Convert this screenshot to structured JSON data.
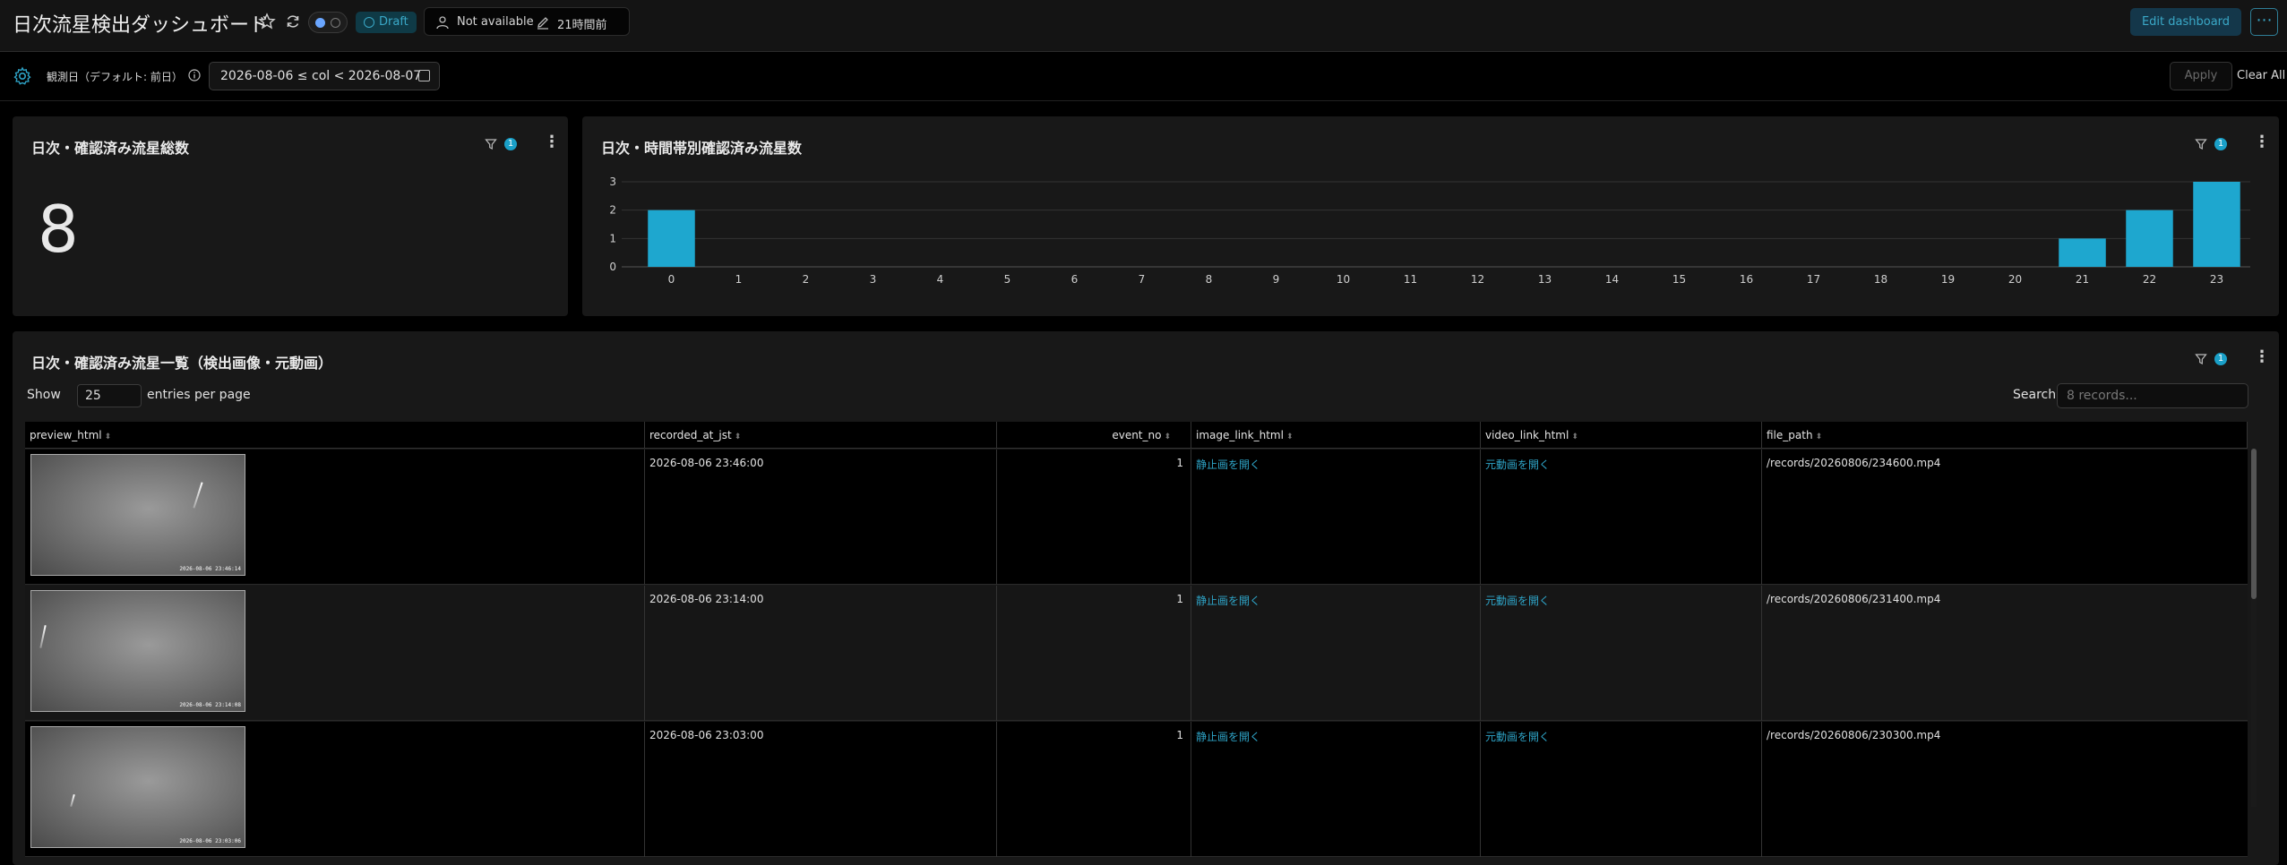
{
  "header": {
    "title": "日次流星検出ダッシュボード",
    "status_badge": "Draft",
    "owner": "Not available",
    "modified": "21時間前",
    "edit_button": "Edit dashboard",
    "more_button": "⋯"
  },
  "filter_bar": {
    "label": "観測日（デフォルト: 前日）",
    "date_range": "2026-08-06 ≤ col < 2026-08-07",
    "apply_button": "Apply",
    "clear_button": "Clear All"
  },
  "kpi_panel": {
    "title": "日次・確認済み流星総数",
    "filter_count": "1",
    "value": "8"
  },
  "chart_panel": {
    "title": "日次・時間帯別確認済み流星数",
    "filter_count": "1"
  },
  "chart_data": {
    "type": "bar",
    "categories": [
      "0",
      "1",
      "2",
      "3",
      "4",
      "5",
      "6",
      "7",
      "8",
      "9",
      "10",
      "11",
      "12",
      "13",
      "14",
      "15",
      "16",
      "17",
      "18",
      "19",
      "20",
      "21",
      "22",
      "23"
    ],
    "values": [
      2,
      0,
      0,
      0,
      0,
      0,
      0,
      0,
      0,
      0,
      0,
      0,
      0,
      0,
      0,
      0,
      0,
      0,
      0,
      0,
      0,
      1,
      2,
      3
    ],
    "y_ticks": [
      "0",
      "1",
      "2",
      "3"
    ],
    "ylim": [
      0,
      3
    ],
    "bar_color": "#1ea7cf",
    "grid": true
  },
  "table_panel": {
    "title": "日次・確認済み流星一覧（検出画像・元動画）",
    "filter_count": "1",
    "show_label": "Show",
    "page_size": "25",
    "show_suffix": "entries per page",
    "search_label": "Search",
    "search_placeholder": "8 records...",
    "columns": [
      "preview_html",
      "recorded_at_jst",
      "event_no",
      "image_link_html",
      "video_link_html",
      "file_path"
    ],
    "rows": [
      {
        "thumb_ts": "2026-08-06 23:46:14",
        "recorded_at_jst": "2026-08-06 23:46:00",
        "event_no": "1",
        "image_link": "静止画を開く",
        "video_link": "元動画を開く",
        "file_path": "/records/20260806/234600.mp4"
      },
      {
        "thumb_ts": "2026-08-06 23:14:08",
        "recorded_at_jst": "2026-08-06 23:14:00",
        "event_no": "1",
        "image_link": "静止画を開く",
        "video_link": "元動画を開く",
        "file_path": "/records/20260806/231400.mp4"
      },
      {
        "thumb_ts": "2026-08-06 23:03:06",
        "recorded_at_jst": "2026-08-06 23:03:00",
        "event_no": "1",
        "image_link": "静止画を開く",
        "video_link": "元動画を開く",
        "file_path": "/records/20260806/230300.mp4"
      }
    ]
  }
}
